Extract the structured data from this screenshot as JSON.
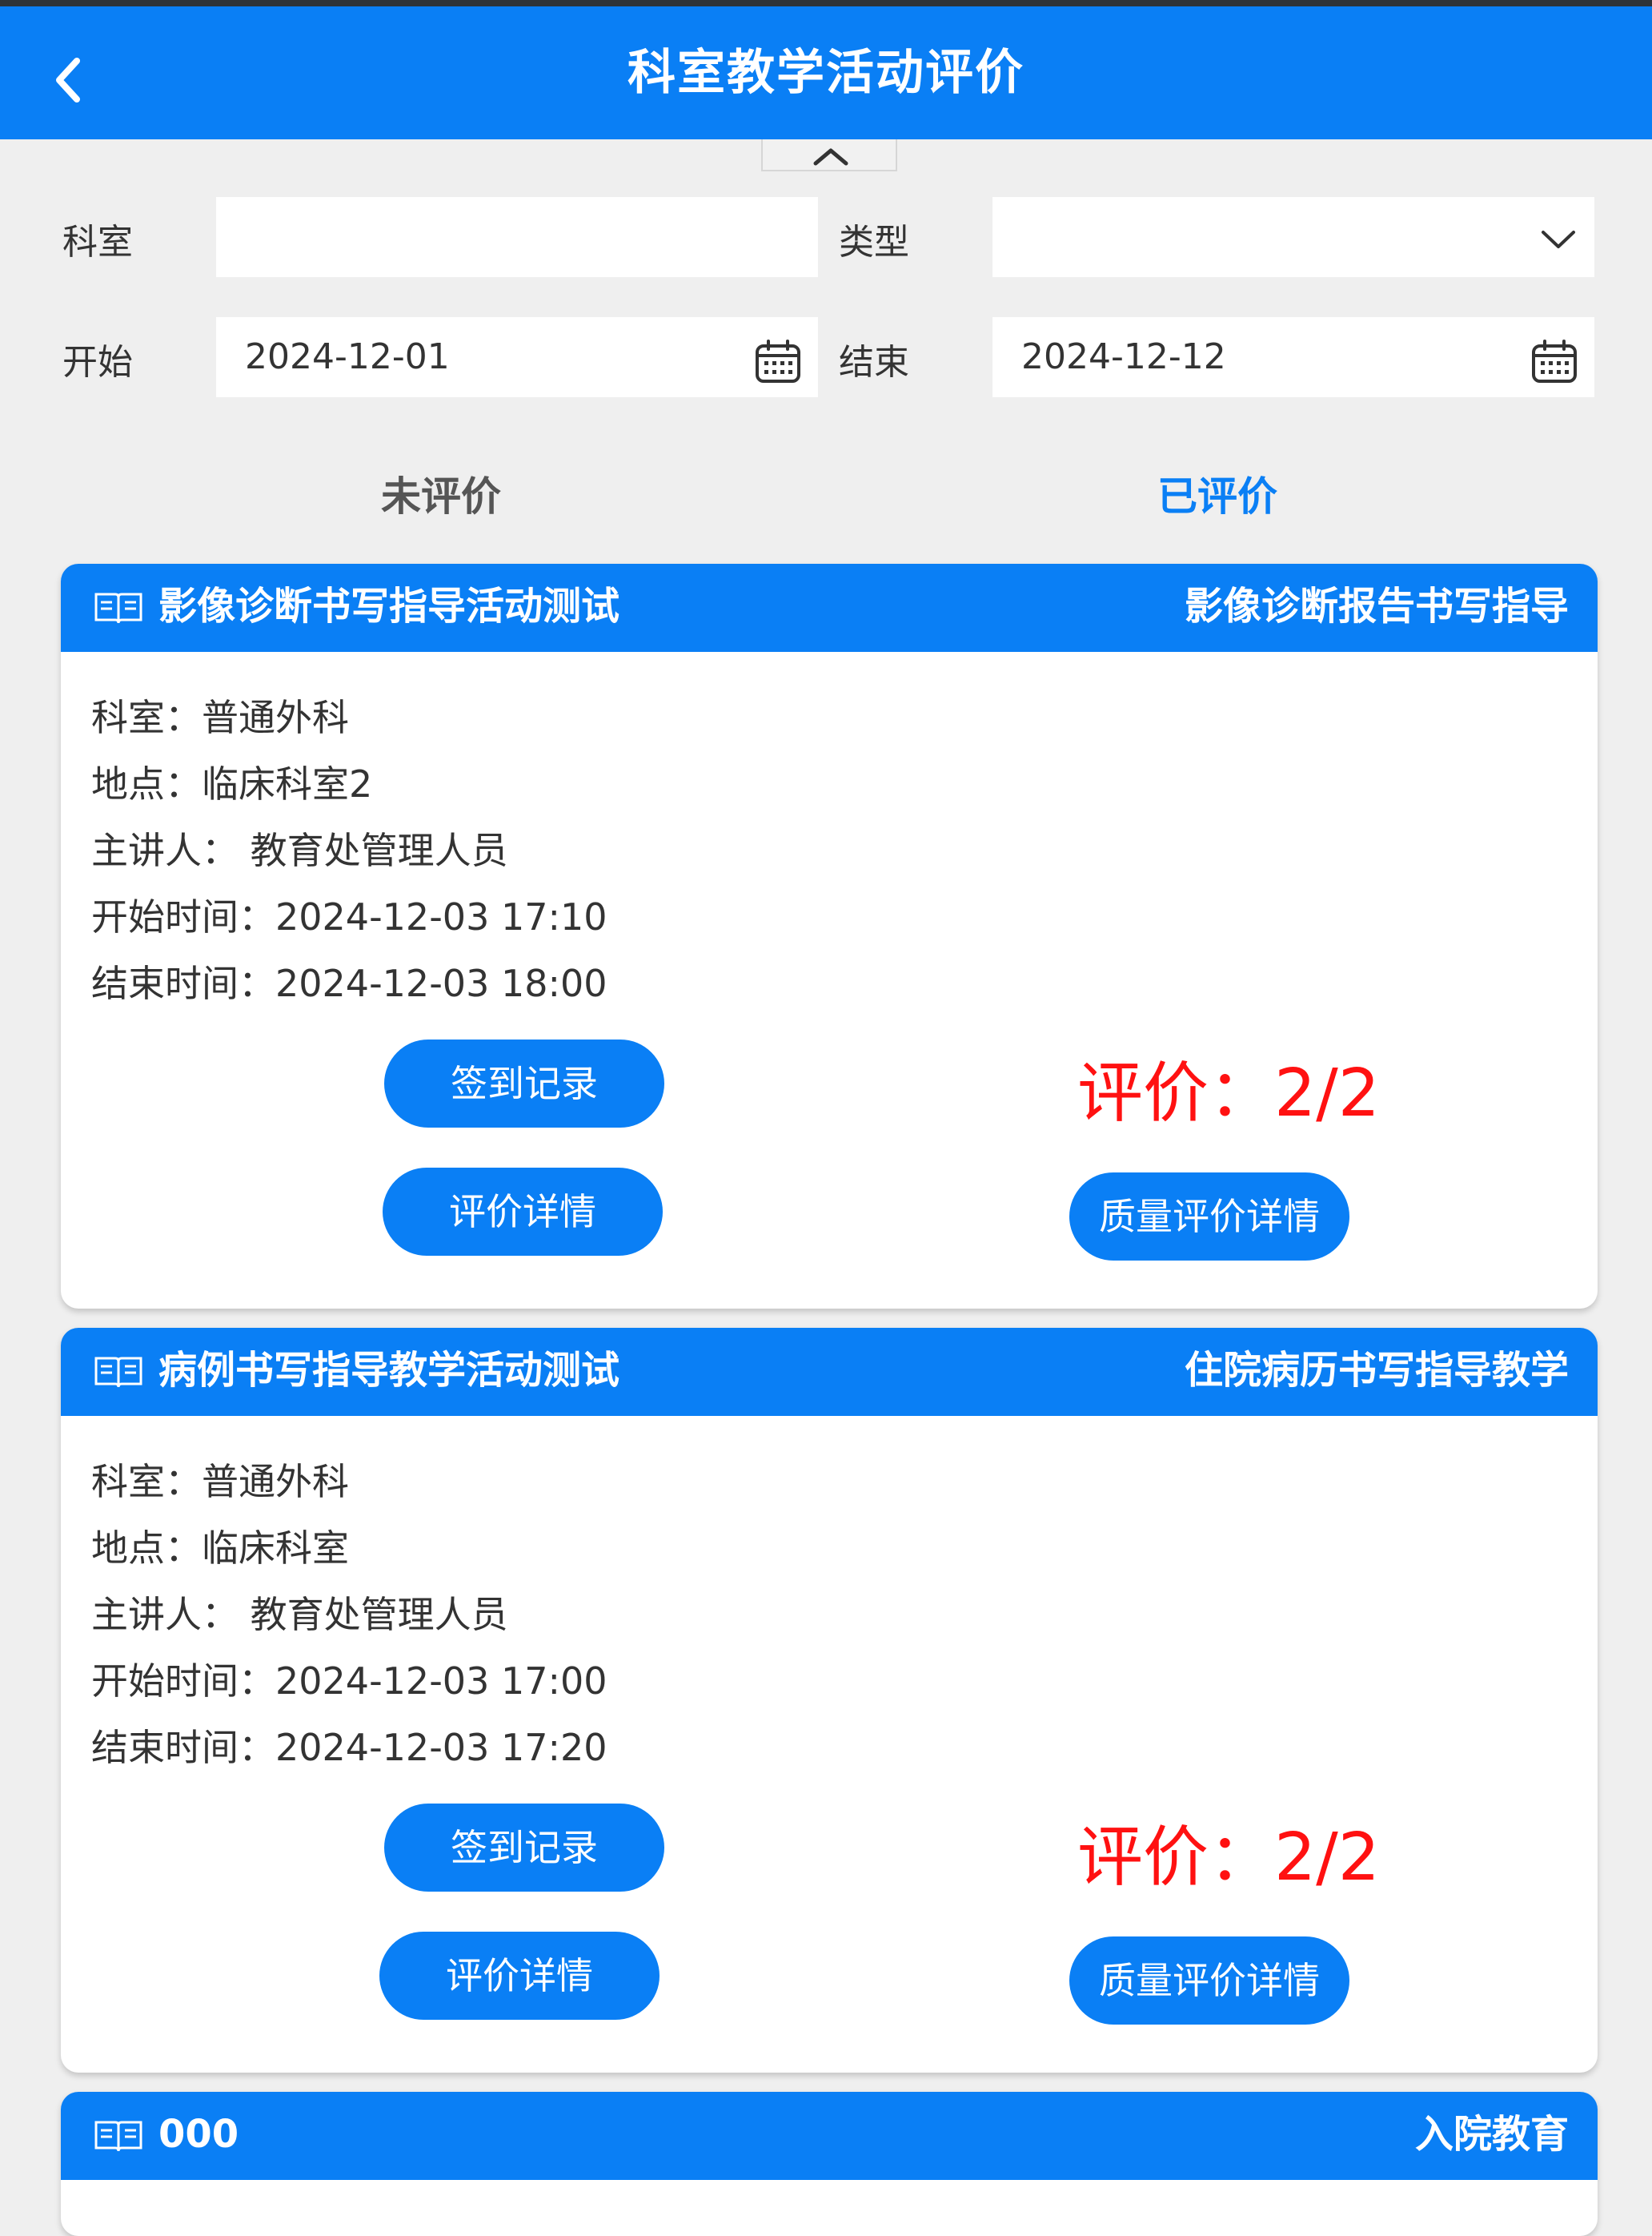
{
  "header": {
    "title": "科室教学活动评价"
  },
  "filters": {
    "department_label": "科室",
    "department_value": "",
    "type_label": "类型",
    "type_value": "",
    "start_label": "开始",
    "start_value": "2024-12-01",
    "end_label": "结束",
    "end_value": "2024-12-12"
  },
  "tabs": [
    {
      "label": "未评价",
      "active": false
    },
    {
      "label": "已评价",
      "active": true
    }
  ],
  "cards": [
    {
      "name": "影像诊断书写指导活动测试",
      "type": "影像诊断报告书写指导",
      "info": [
        "科室：普通外科",
        "地点：临床科室2",
        "主讲人： 教育处管理人员",
        "开始时间：2024-12-03 17:10",
        "结束时间：2024-12-03 18:00"
      ],
      "signin_label": "签到记录",
      "detail_label": "评价详情",
      "score_label": "评价：2/2",
      "quality_label": "质量评价详情"
    },
    {
      "name": "病例书写指导教学活动测试",
      "type": "住院病历书写指导教学",
      "info": [
        "科室：普通外科",
        "地点：临床科室",
        "主讲人： 教育处管理人员",
        "开始时间：2024-12-03 17:00",
        "结束时间：2024-12-03 17:20"
      ],
      "signin_label": "签到记录",
      "detail_label": "评价详情",
      "score_label": "评价：2/2",
      "quality_label": "质量评价详情"
    },
    {
      "name": "000",
      "type": "入院教育"
    }
  ],
  "colors": {
    "primary": "#0a7ff5",
    "score": "#ff1111",
    "background": "#efefef"
  }
}
